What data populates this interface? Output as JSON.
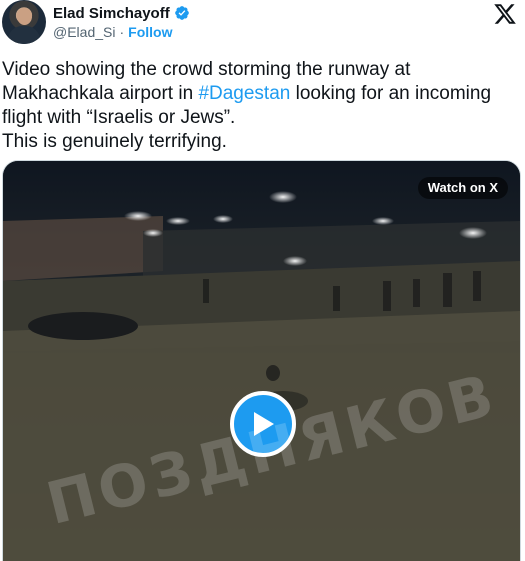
{
  "author": {
    "name": "Elad Simchayoff",
    "handle": "@Elad_Si",
    "separator": "·",
    "follow_label": "Follow",
    "verified_color": "#1d9bf0"
  },
  "brand_icon": "x-logo-icon",
  "tweet": {
    "line1": "Video showing the crowd storming the runway at",
    "line2_before": "Makhachkala airport in ",
    "hashtag": "#Dagestan",
    "line2_after": " looking for an incoming",
    "line3": "flight with “Israelis or Jews”.",
    "line4": "This is genuinely terrifying."
  },
  "media": {
    "watch_label": "Watch on X",
    "play_icon": "play-icon",
    "watermark": "ПОЗДНЯКОВ"
  },
  "colors": {
    "accent": "#1d9bf0",
    "text": "#0f1419",
    "muted": "#536471"
  }
}
